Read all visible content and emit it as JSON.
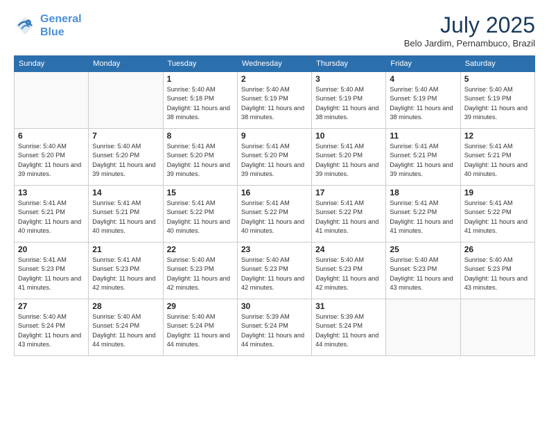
{
  "header": {
    "logo_line1": "General",
    "logo_line2": "Blue",
    "month_year": "July 2025",
    "location": "Belo Jardim, Pernambuco, Brazil"
  },
  "days_of_week": [
    "Sunday",
    "Monday",
    "Tuesday",
    "Wednesday",
    "Thursday",
    "Friday",
    "Saturday"
  ],
  "weeks": [
    [
      {
        "day": "",
        "info": ""
      },
      {
        "day": "",
        "info": ""
      },
      {
        "day": "1",
        "info": "Sunrise: 5:40 AM\nSunset: 5:18 PM\nDaylight: 11 hours and 38 minutes."
      },
      {
        "day": "2",
        "info": "Sunrise: 5:40 AM\nSunset: 5:19 PM\nDaylight: 11 hours and 38 minutes."
      },
      {
        "day": "3",
        "info": "Sunrise: 5:40 AM\nSunset: 5:19 PM\nDaylight: 11 hours and 38 minutes."
      },
      {
        "day": "4",
        "info": "Sunrise: 5:40 AM\nSunset: 5:19 PM\nDaylight: 11 hours and 38 minutes."
      },
      {
        "day": "5",
        "info": "Sunrise: 5:40 AM\nSunset: 5:19 PM\nDaylight: 11 hours and 39 minutes."
      }
    ],
    [
      {
        "day": "6",
        "info": "Sunrise: 5:40 AM\nSunset: 5:20 PM\nDaylight: 11 hours and 39 minutes."
      },
      {
        "day": "7",
        "info": "Sunrise: 5:40 AM\nSunset: 5:20 PM\nDaylight: 11 hours and 39 minutes."
      },
      {
        "day": "8",
        "info": "Sunrise: 5:41 AM\nSunset: 5:20 PM\nDaylight: 11 hours and 39 minutes."
      },
      {
        "day": "9",
        "info": "Sunrise: 5:41 AM\nSunset: 5:20 PM\nDaylight: 11 hours and 39 minutes."
      },
      {
        "day": "10",
        "info": "Sunrise: 5:41 AM\nSunset: 5:20 PM\nDaylight: 11 hours and 39 minutes."
      },
      {
        "day": "11",
        "info": "Sunrise: 5:41 AM\nSunset: 5:21 PM\nDaylight: 11 hours and 39 minutes."
      },
      {
        "day": "12",
        "info": "Sunrise: 5:41 AM\nSunset: 5:21 PM\nDaylight: 11 hours and 40 minutes."
      }
    ],
    [
      {
        "day": "13",
        "info": "Sunrise: 5:41 AM\nSunset: 5:21 PM\nDaylight: 11 hours and 40 minutes."
      },
      {
        "day": "14",
        "info": "Sunrise: 5:41 AM\nSunset: 5:21 PM\nDaylight: 11 hours and 40 minutes."
      },
      {
        "day": "15",
        "info": "Sunrise: 5:41 AM\nSunset: 5:22 PM\nDaylight: 11 hours and 40 minutes."
      },
      {
        "day": "16",
        "info": "Sunrise: 5:41 AM\nSunset: 5:22 PM\nDaylight: 11 hours and 40 minutes."
      },
      {
        "day": "17",
        "info": "Sunrise: 5:41 AM\nSunset: 5:22 PM\nDaylight: 11 hours and 41 minutes."
      },
      {
        "day": "18",
        "info": "Sunrise: 5:41 AM\nSunset: 5:22 PM\nDaylight: 11 hours and 41 minutes."
      },
      {
        "day": "19",
        "info": "Sunrise: 5:41 AM\nSunset: 5:22 PM\nDaylight: 11 hours and 41 minutes."
      }
    ],
    [
      {
        "day": "20",
        "info": "Sunrise: 5:41 AM\nSunset: 5:23 PM\nDaylight: 11 hours and 41 minutes."
      },
      {
        "day": "21",
        "info": "Sunrise: 5:41 AM\nSunset: 5:23 PM\nDaylight: 11 hours and 42 minutes."
      },
      {
        "day": "22",
        "info": "Sunrise: 5:40 AM\nSunset: 5:23 PM\nDaylight: 11 hours and 42 minutes."
      },
      {
        "day": "23",
        "info": "Sunrise: 5:40 AM\nSunset: 5:23 PM\nDaylight: 11 hours and 42 minutes."
      },
      {
        "day": "24",
        "info": "Sunrise: 5:40 AM\nSunset: 5:23 PM\nDaylight: 11 hours and 42 minutes."
      },
      {
        "day": "25",
        "info": "Sunrise: 5:40 AM\nSunset: 5:23 PM\nDaylight: 11 hours and 43 minutes."
      },
      {
        "day": "26",
        "info": "Sunrise: 5:40 AM\nSunset: 5:23 PM\nDaylight: 11 hours and 43 minutes."
      }
    ],
    [
      {
        "day": "27",
        "info": "Sunrise: 5:40 AM\nSunset: 5:24 PM\nDaylight: 11 hours and 43 minutes."
      },
      {
        "day": "28",
        "info": "Sunrise: 5:40 AM\nSunset: 5:24 PM\nDaylight: 11 hours and 44 minutes."
      },
      {
        "day": "29",
        "info": "Sunrise: 5:40 AM\nSunset: 5:24 PM\nDaylight: 11 hours and 44 minutes."
      },
      {
        "day": "30",
        "info": "Sunrise: 5:39 AM\nSunset: 5:24 PM\nDaylight: 11 hours and 44 minutes."
      },
      {
        "day": "31",
        "info": "Sunrise: 5:39 AM\nSunset: 5:24 PM\nDaylight: 11 hours and 44 minutes."
      },
      {
        "day": "",
        "info": ""
      },
      {
        "day": "",
        "info": ""
      }
    ]
  ]
}
